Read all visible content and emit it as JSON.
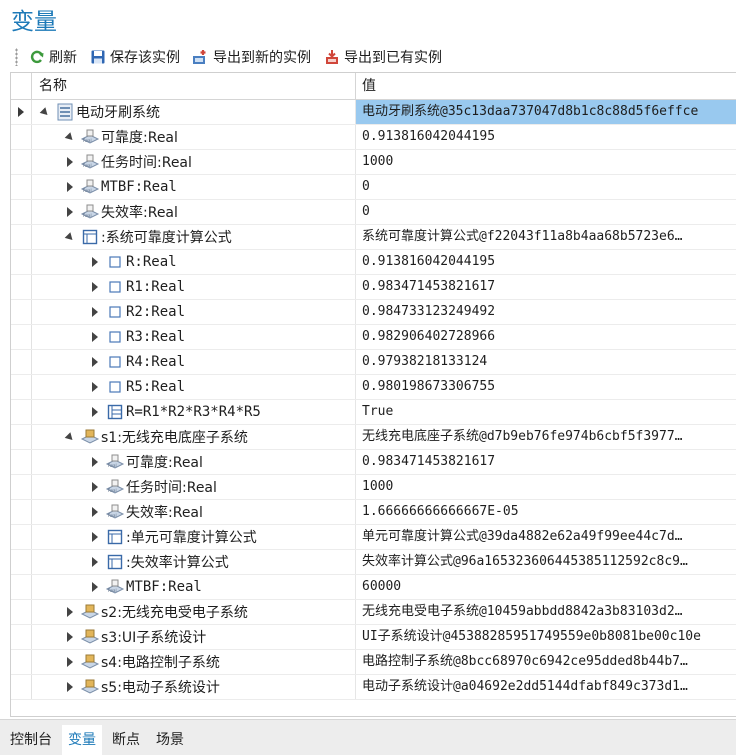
{
  "panel": {
    "title": "变量"
  },
  "toolbar": {
    "refresh": {
      "label": "刷新",
      "icon": "refresh-icon"
    },
    "save": {
      "label": "保存该实例",
      "icon": "save-icon"
    },
    "export_new": {
      "label": "导出到新的实例",
      "icon": "export-new-icon"
    },
    "export_existing": {
      "label": "导出到已有实例",
      "icon": "export-existing-icon"
    }
  },
  "tree": {
    "headers": {
      "name": "名称",
      "value": "值"
    },
    "rows": [
      {
        "level": 0,
        "expanded": true,
        "icon": "system-icon",
        "name": "电动牙刷系统",
        "value": "电动牙刷系统@35c13daa737047d8b1c8c88d5f6effce",
        "selected": true
      },
      {
        "level": 1,
        "expanded": true,
        "icon": "real-var-icon",
        "name": "可靠度:Real",
        "value": "0.913816042044195"
      },
      {
        "level": 1,
        "expanded": false,
        "icon": "real-var-icon",
        "name": "任务时间:Real",
        "value": "1000"
      },
      {
        "level": 1,
        "expanded": false,
        "icon": "real-var-icon",
        "name": "MTBF:Real",
        "value": "0"
      },
      {
        "level": 1,
        "expanded": false,
        "icon": "real-var-icon",
        "name": "失效率:Real",
        "value": "0"
      },
      {
        "level": 1,
        "expanded": true,
        "icon": "formula-icon",
        "name": ":系统可靠度计算公式",
        "value": "系统可靠度计算公式@f22043f11a8b4aa68b5723e6…"
      },
      {
        "level": 2,
        "expanded": false,
        "icon": "param-icon",
        "name": "R:Real",
        "value": "0.913816042044195"
      },
      {
        "level": 2,
        "expanded": false,
        "icon": "param-icon",
        "name": "R1:Real",
        "value": "0.983471453821617"
      },
      {
        "level": 2,
        "expanded": false,
        "icon": "param-icon",
        "name": "R2:Real",
        "value": "0.984733123249492"
      },
      {
        "level": 2,
        "expanded": false,
        "icon": "param-icon",
        "name": "R3:Real",
        "value": "0.982906402728966"
      },
      {
        "level": 2,
        "expanded": false,
        "icon": "param-icon",
        "name": "R4:Real",
        "value": "0.97938218133124"
      },
      {
        "level": 2,
        "expanded": false,
        "icon": "param-icon",
        "name": "R5:Real",
        "value": "0.980198673306755"
      },
      {
        "level": 2,
        "expanded": false,
        "icon": "expression-icon",
        "name": "R=R1*R2*R3*R4*R5",
        "value": "True"
      },
      {
        "level": 1,
        "expanded": true,
        "icon": "subsystem-icon",
        "name": "s1:无线充电底座子系统",
        "value": "无线充电底座子系统@d7b9eb76fe974b6cbf5f3977…"
      },
      {
        "level": 2,
        "expanded": false,
        "icon": "real-var-icon",
        "name": "可靠度:Real",
        "value": "0.983471453821617"
      },
      {
        "level": 2,
        "expanded": false,
        "icon": "real-var-icon",
        "name": "任务时间:Real",
        "value": "1000"
      },
      {
        "level": 2,
        "expanded": false,
        "icon": "real-var-icon",
        "name": "失效率:Real",
        "value": "1.66666666666667E-05"
      },
      {
        "level": 2,
        "expanded": false,
        "icon": "formula-icon",
        "name": ":单元可靠度计算公式",
        "value": "单元可靠度计算公式@39da4882e62a49f99ee44c7d…"
      },
      {
        "level": 2,
        "expanded": false,
        "icon": "formula-icon",
        "name": ":失效率计算公式",
        "value": "失效率计算公式@96a16532360644538511259​2c8c9…"
      },
      {
        "level": 2,
        "expanded": false,
        "icon": "real-var-icon",
        "name": "MTBF:Real",
        "value": "60000"
      },
      {
        "level": 1,
        "expanded": false,
        "icon": "subsystem-icon",
        "name": "s2:无线充电受电子系统",
        "value": "无线充电受电子系统@10459abbdd8842a3b83103d2…"
      },
      {
        "level": 1,
        "expanded": false,
        "icon": "subsystem-icon",
        "name": "s3:UI子系统设计",
        "value": "UI子系统设计@45388285951749559e0b8081be00c10e"
      },
      {
        "level": 1,
        "expanded": false,
        "icon": "subsystem-icon",
        "name": "s4:电路控制子系统",
        "value": "电路控制子系统@8bcc68970c6942ce95dded8b44b7…"
      },
      {
        "level": 1,
        "expanded": false,
        "icon": "subsystem-icon",
        "name": "s5:电动子系统设计",
        "value": "电动子系统设计@a04692e2dd5144dfabf849c373d1…"
      }
    ]
  },
  "bottom_tabs": [
    {
      "label": "控制台",
      "active": false
    },
    {
      "label": "变量",
      "active": true
    },
    {
      "label": "断点",
      "active": false
    },
    {
      "label": "场景",
      "active": false
    }
  ],
  "colors": {
    "accent": "#1e7ab8",
    "selection": "#99c9ef"
  }
}
